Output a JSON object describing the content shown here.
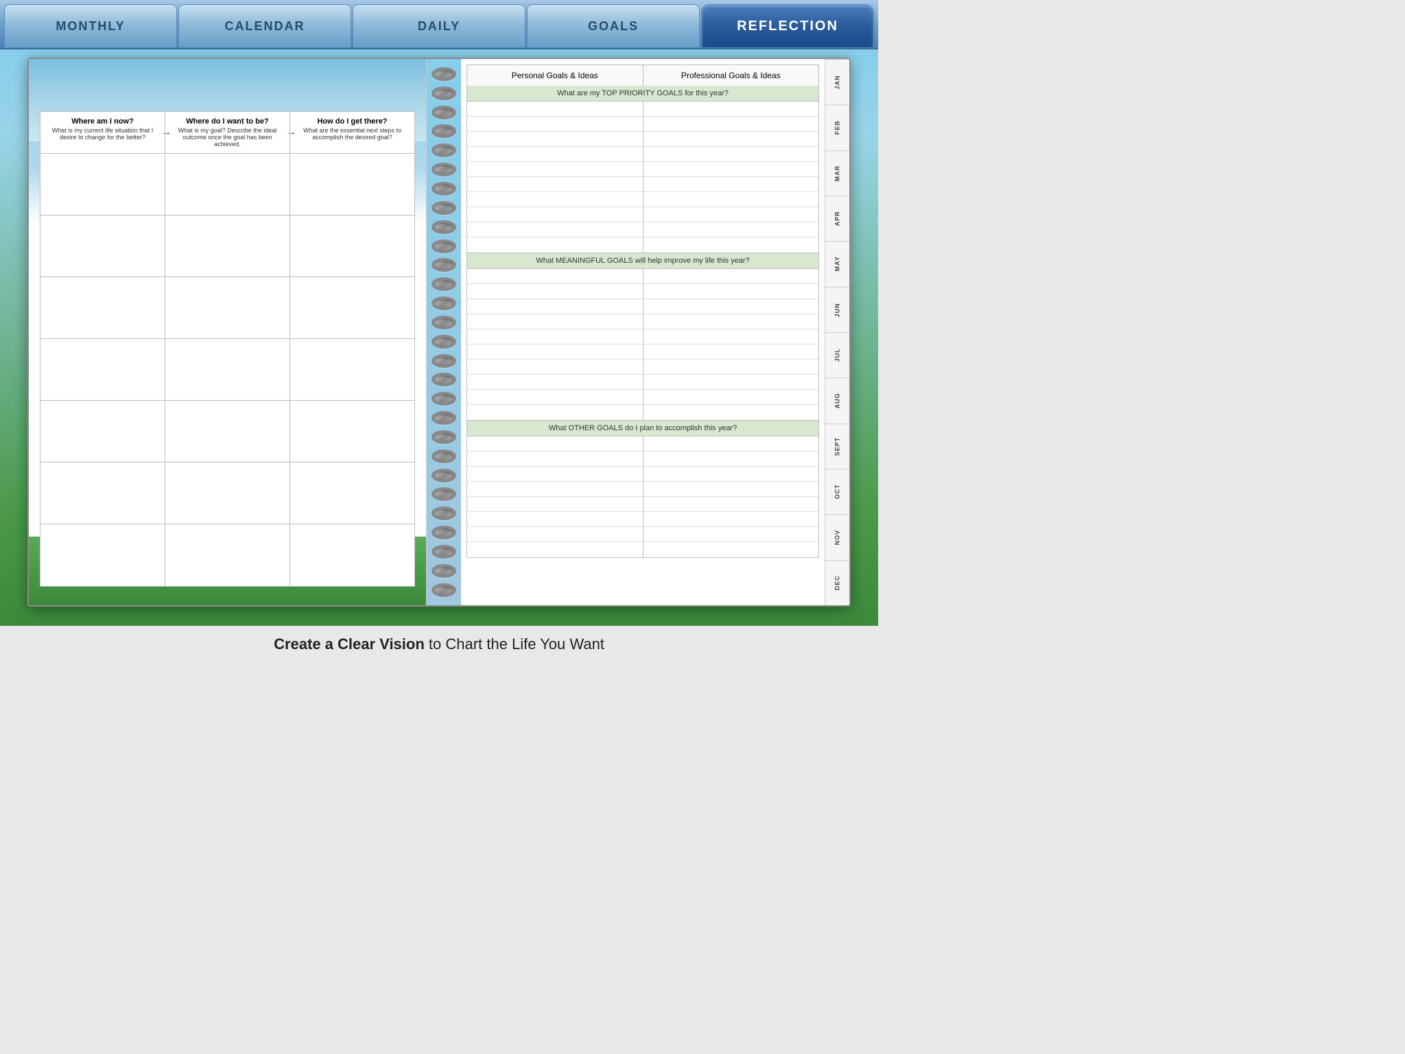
{
  "nav": {
    "tabs": [
      {
        "label": "MONTHLY",
        "active": false
      },
      {
        "label": "CALENDAR",
        "active": false
      },
      {
        "label": "DAILY",
        "active": false
      },
      {
        "label": "GOALS",
        "active": false
      },
      {
        "label": "REFLECTION",
        "active": true
      }
    ]
  },
  "left_page": {
    "headers": [
      {
        "title": "Where am I now?",
        "subtitle": "What is my current life situation that I desire to change for the better?"
      },
      {
        "title": "Where do I want to be?",
        "subtitle": "What is my goal? Describe the ideal outcome once the goal has been achieved."
      },
      {
        "title": "How do I get there?",
        "subtitle": "What are the essential next steps to accomplish the desired goal?"
      }
    ],
    "rows": 7
  },
  "right_page": {
    "col_headers": [
      "Personal Goals & Ideas",
      "Professional Goals & Ideas"
    ],
    "top_priority_label": "What are my TOP PRIORITY GOALS for this year?",
    "top_priority_lines": 10,
    "meaningful_label": "What MEANINGFUL GOALS will help improve my life this year?",
    "meaningful_lines": 10,
    "other_label": "What OTHER GOALS do I plan to accomplish this year?",
    "other_lines": 8
  },
  "month_tabs": [
    "JAN",
    "FEB",
    "MAR",
    "APR",
    "MAY",
    "JUN",
    "JUL",
    "AUG",
    "SEPT",
    "OCT",
    "NOV",
    "DEC"
  ],
  "tagline": {
    "bold": "Create a Clear Vision",
    "rest": " to Chart the Life You Want"
  },
  "spiral": {
    "count": 28
  }
}
